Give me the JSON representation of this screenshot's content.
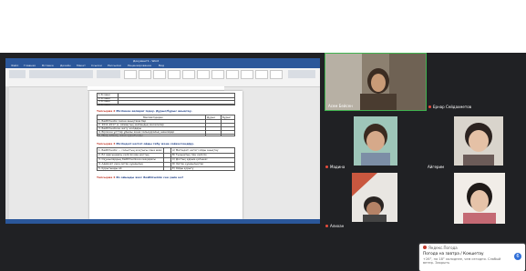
{
  "word": {
    "title": "Документ1 - Word",
    "tabs": [
      "Файл",
      "Главная",
      "Вставка",
      "Дизайн",
      "Макет",
      "Ссылки",
      "Рассылки",
      "Рецензирование",
      "Вид"
    ],
    "top_table_rows": [
      "1 Кі мәні",
      "2 Кі мәні",
      "3 Кі мәні",
      "4 Кі мәні"
    ],
    "task2": {
      "label": "Тапсырма 2",
      "text": " Мәтіннен ақпарат іздеу. Дұрыс/бұрыс анықтау.",
      "col_true": "Дұрыс",
      "col_false": "Бұрыс",
      "header": "Мәлімет/дерек",
      "rows": [
        "1. Бейбітшілік сөзіне анықтама бер",
        "2. 2011-2017 ж. Аймақтық-жаһандық мәселелер",
        "3. Бейбітшілікке жету жолдары",
        "4. Біріккен ұлттар ұйымы және халықаралық шешімдер",
        "5. Пікір алмасу және қорытынды"
      ]
    },
    "task3": {
      "label": "Тапсырма 3",
      "text": " Мәтіндегі негізгі ойды табу және сәйкестендіру.",
      "left": [
        "1. Бейбітшілік — соғыстың жоқтығы ғана емес",
        "2. Ел арасындағы келісім мен достық",
        "3. Оқушылардың бейбітшілікке көзқарасы",
        "4. Адамзат үшін ортақ құндылық",
        "5. Қорытынды ой"
      ],
      "right": [
        "A) Мәтіндегі негізгі ойды анықтау",
        "B) Тыныштық пен келісім",
        "C) Достық қарым-қатынас",
        "D) Ортақ құндылықтар",
        "E) Ойды қорыту"
      ]
    },
    "task4": {
      "label": "Тапсырма 4",
      "text": " Өз ойыңды жаз: Бейбітшілік сен үшін не?"
    }
  },
  "participants": [
    {
      "name": "Асем Бейсен",
      "position": "top-right-large"
    },
    {
      "name": "Ернар Сейдахметов",
      "position": "second-row-right"
    },
    {
      "name": "Мадина",
      "position": "second-row-left"
    },
    {
      "name": "Айгерим",
      "position": "second-row-right-label"
    },
    {
      "name": "Алихан",
      "position": "third-row-left"
    }
  ],
  "notification": {
    "source": "Яндекс.Погода",
    "title": "Погода на завтра / Кокшетау",
    "body": "+26°, на 18° холоднее, чем сегодня. Слабый ветер. Закрыть",
    "badge": "6"
  },
  "colors": {
    "meeting_bg": "#202124",
    "word_brand": "#2b579a",
    "task_label": "#c0392b"
  }
}
